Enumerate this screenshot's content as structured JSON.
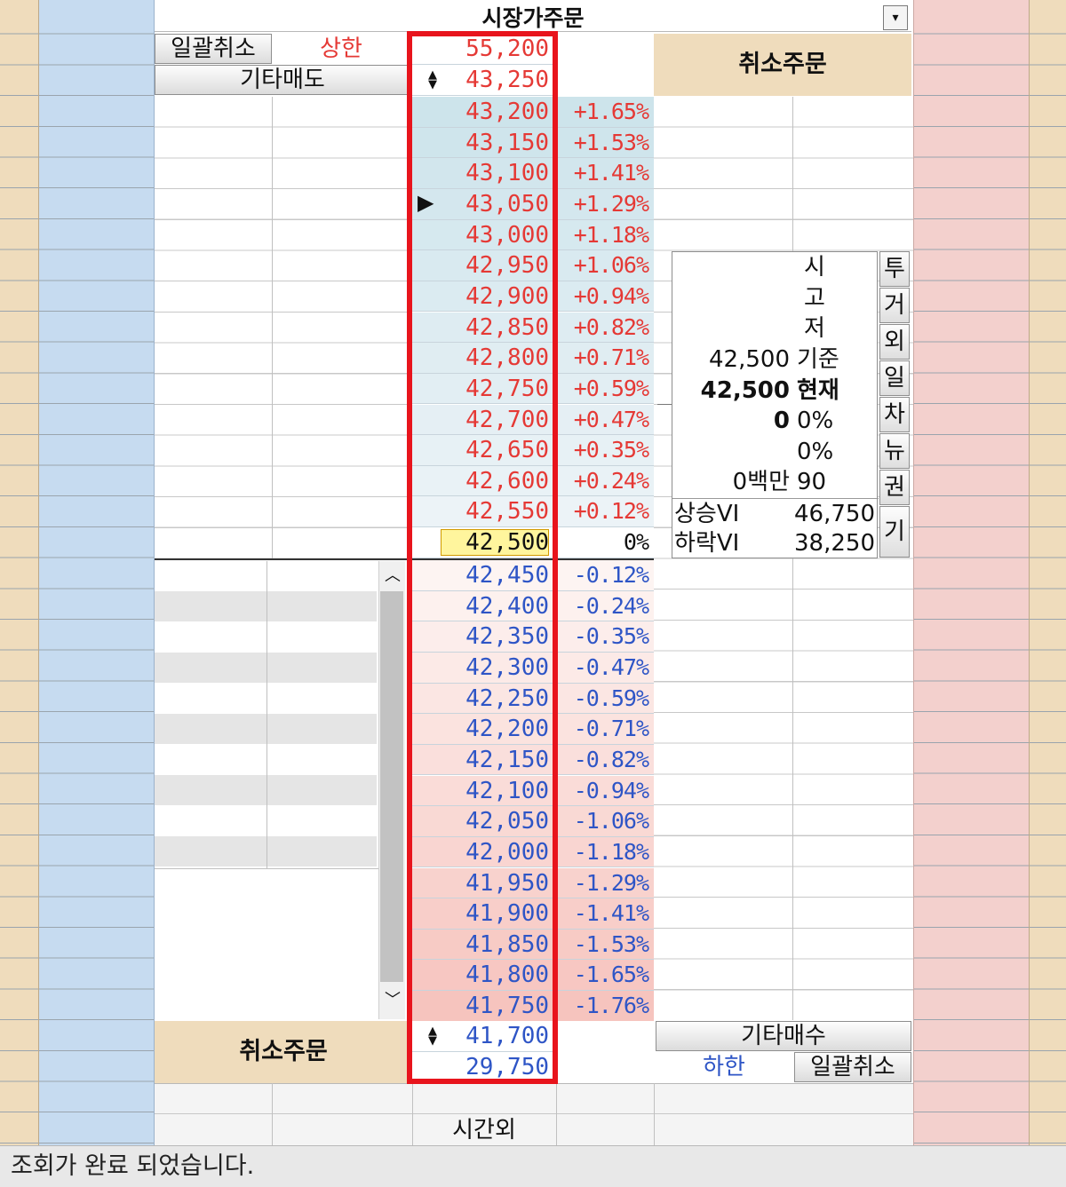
{
  "header": {
    "title": "시장가주문",
    "dropdown_icon": "▾"
  },
  "sell_panel": {
    "bulk_cancel": "일괄취소",
    "upper_limit_label": "상한",
    "other_sell": "기타매도",
    "cancel_order": "취소주문"
  },
  "buy_panel": {
    "cancel_order": "취소주문",
    "other_buy": "기타매수",
    "lower_limit_label": "하한",
    "bulk_cancel": "일괄취소"
  },
  "prices": {
    "upper_limit": "55,200",
    "top_spinner": "43,250",
    "bottom_spinner": "41,700",
    "lower_limit": "29,750"
  },
  "asks": [
    {
      "price": "43,200",
      "pct": "+1.65%"
    },
    {
      "price": "43,150",
      "pct": "+1.53%"
    },
    {
      "price": "43,100",
      "pct": "+1.41%"
    },
    {
      "price": "43,050",
      "pct": "+1.29%"
    },
    {
      "price": "43,000",
      "pct": "+1.18%"
    },
    {
      "price": "42,950",
      "pct": "+1.06%"
    },
    {
      "price": "42,900",
      "pct": "+0.94%"
    },
    {
      "price": "42,850",
      "pct": "+0.82%"
    },
    {
      "price": "42,800",
      "pct": "+0.71%"
    },
    {
      "price": "42,750",
      "pct": "+0.59%"
    },
    {
      "price": "42,700",
      "pct": "+0.47%"
    },
    {
      "price": "42,650",
      "pct": "+0.35%"
    },
    {
      "price": "42,600",
      "pct": "+0.24%"
    },
    {
      "price": "42,550",
      "pct": "+0.12%"
    },
    {
      "price": "42,500",
      "pct": "0%"
    }
  ],
  "bids": [
    {
      "price": "42,450",
      "pct": "-0.12%"
    },
    {
      "price": "42,400",
      "pct": "-0.24%"
    },
    {
      "price": "42,350",
      "pct": "-0.35%"
    },
    {
      "price": "42,300",
      "pct": "-0.47%"
    },
    {
      "price": "42,250",
      "pct": "-0.59%"
    },
    {
      "price": "42,200",
      "pct": "-0.71%"
    },
    {
      "price": "42,150",
      "pct": "-0.82%"
    },
    {
      "price": "42,100",
      "pct": "-0.94%"
    },
    {
      "price": "42,050",
      "pct": "-1.06%"
    },
    {
      "price": "42,000",
      "pct": "-1.18%"
    },
    {
      "price": "41,950",
      "pct": "-1.29%"
    },
    {
      "price": "41,900",
      "pct": "-1.41%"
    },
    {
      "price": "41,850",
      "pct": "-1.53%"
    },
    {
      "price": "41,800",
      "pct": "-1.65%"
    },
    {
      "price": "41,750",
      "pct": "-1.76%"
    }
  ],
  "info": {
    "open_label": "시",
    "high_label": "고",
    "low_label": "저",
    "base_value": "42,500",
    "base_label": "기준",
    "current_value": "42,500",
    "current_label": "현재",
    "volume_value": "0",
    "volume_pct": "0%",
    "prev_pct": "0%",
    "amount_value": "0백만",
    "amount_ratio": "90",
    "vi_up_label": "상승VI",
    "vi_up_value": "46,750",
    "vi_down_label": "하락VI",
    "vi_down_value": "38,250"
  },
  "side_tabs": [
    "투",
    "거",
    "외",
    "일",
    "차",
    "뉴",
    "권",
    "기"
  ],
  "footer": {
    "after_hours": "시간외",
    "status": "조회가 완료 되었습니다."
  },
  "colors": {
    "ask_text": "#e53935",
    "bid_text": "#2e55c6",
    "current_price_bg": "#fff59d",
    "highlight_box": "#e8141c"
  }
}
